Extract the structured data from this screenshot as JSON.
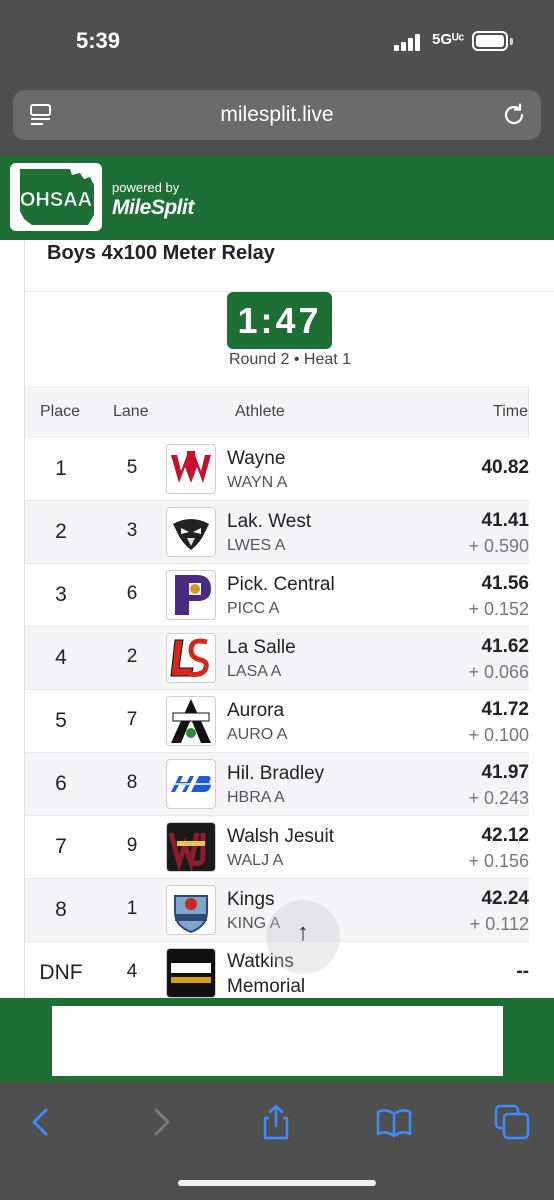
{
  "status_bar": {
    "time": "5:39",
    "network": "5Gᵁᶜ"
  },
  "browser": {
    "url": "milesplit.live"
  },
  "site_header": {
    "logo_text": "OHSAA",
    "powered_by": "powered by",
    "brand": "MileSplit"
  },
  "event": {
    "title": "Boys 4x100 Meter Relay",
    "timer": "1:47",
    "round_heat": "Round 2 • Heat 1"
  },
  "results": {
    "columns": {
      "place": "Place",
      "lane": "Lane",
      "athlete": "Athlete",
      "time": "Time"
    },
    "rows": [
      {
        "place": "1",
        "lane": "5",
        "team": "Wayne",
        "code": "WAYN A",
        "time": "40.82",
        "gap": ""
      },
      {
        "place": "2",
        "lane": "3",
        "team": "Lak. West",
        "code": "LWES A",
        "time": "41.41",
        "gap": "+ 0.590"
      },
      {
        "place": "3",
        "lane": "6",
        "team": "Pick. Central",
        "code": "PICC A",
        "time": "41.56",
        "gap": "+ 0.152"
      },
      {
        "place": "4",
        "lane": "2",
        "team": "La Salle",
        "code": "LASA A",
        "time": "41.62",
        "gap": "+ 0.066"
      },
      {
        "place": "5",
        "lane": "7",
        "team": "Aurora",
        "code": "AURO A",
        "time": "41.72",
        "gap": "+ 0.100"
      },
      {
        "place": "6",
        "lane": "8",
        "team": "Hil. Bradley",
        "code": "HBRA A",
        "time": "41.97",
        "gap": "+ 0.243"
      },
      {
        "place": "7",
        "lane": "9",
        "team": "Walsh Jesuit",
        "code": "WALJ A",
        "time": "42.12",
        "gap": "+ 0.156"
      },
      {
        "place": "8",
        "lane": "1",
        "team": "Kings",
        "code": "KING A",
        "time": "42.24",
        "gap": "+ 0.112"
      },
      {
        "place": "DNF",
        "lane": "4",
        "team": "Watkins Memorial",
        "code": "",
        "time": "--",
        "gap": ""
      }
    ]
  },
  "scroll_top": {
    "icon": "arrow-up-icon",
    "glyph": "↑"
  },
  "colors": {
    "brand_green": "#1e6f35",
    "browser_chrome": "#4f4f4f",
    "ios_blue": "#3d8bfd"
  }
}
